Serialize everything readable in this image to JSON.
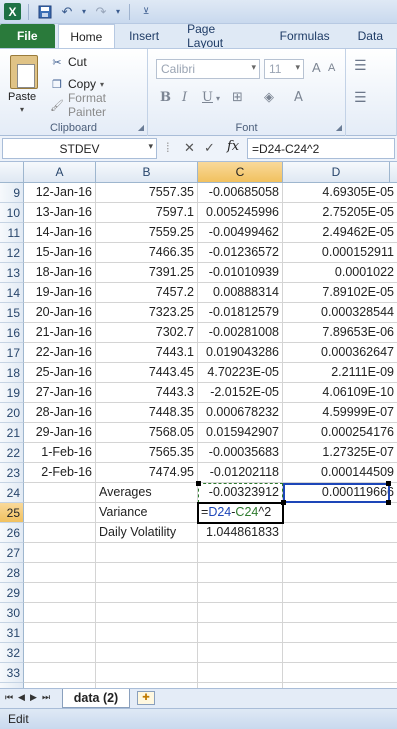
{
  "quick_access": {
    "app_icon_label": "X",
    "icons": [
      "save-icon",
      "undo-icon",
      "redo-icon",
      "customize-arrow-icon"
    ]
  },
  "tabs": [
    "File",
    "Home",
    "Insert",
    "Page Layout",
    "Formulas",
    "Data"
  ],
  "ribbon": {
    "clipboard": {
      "paste": "Paste",
      "cut": "Cut",
      "copy": "Copy",
      "format_painter": "Format Painter",
      "label": "Clipboard"
    },
    "font": {
      "font_name": "Calibri",
      "font_size": "11",
      "label": "Font",
      "grow": "A",
      "shrink": "A",
      "bold": "B",
      "italic": "I",
      "underline": "U"
    }
  },
  "formula_bar": {
    "name_box": "STDEV",
    "cancel": "✕",
    "enter": "✓",
    "fx": "fx",
    "formula": "=D24-C24^2"
  },
  "columns": [
    "A",
    "B",
    "C",
    "D"
  ],
  "rows": [
    {
      "n": "9",
      "a": "12-Jan-16",
      "b": "7557.35",
      "c": "-0.00685058",
      "d": "4.69305E-05"
    },
    {
      "n": "10",
      "a": "13-Jan-16",
      "b": "7597.1",
      "c": "0.005245996",
      "d": "2.75205E-05"
    },
    {
      "n": "11",
      "a": "14-Jan-16",
      "b": "7559.25",
      "c": "-0.00499462",
      "d": "2.49462E-05"
    },
    {
      "n": "12",
      "a": "15-Jan-16",
      "b": "7466.35",
      "c": "-0.01236572",
      "d": "0.000152911"
    },
    {
      "n": "13",
      "a": "18-Jan-16",
      "b": "7391.25",
      "c": "-0.01010939",
      "d": "0.0001022"
    },
    {
      "n": "14",
      "a": "19-Jan-16",
      "b": "7457.2",
      "c": "0.00888314",
      "d": "7.89102E-05"
    },
    {
      "n": "15",
      "a": "20-Jan-16",
      "b": "7323.25",
      "c": "-0.01812579",
      "d": "0.000328544"
    },
    {
      "n": "16",
      "a": "21-Jan-16",
      "b": "7302.7",
      "c": "-0.00281008",
      "d": "7.89653E-06"
    },
    {
      "n": "17",
      "a": "22-Jan-16",
      "b": "7443.1",
      "c": "0.019043286",
      "d": "0.000362647"
    },
    {
      "n": "18",
      "a": "25-Jan-16",
      "b": "7443.45",
      "c": "4.70223E-05",
      "d": "2.2111E-09"
    },
    {
      "n": "19",
      "a": "27-Jan-16",
      "b": "7443.3",
      "c": "-2.0152E-05",
      "d": "4.06109E-10"
    },
    {
      "n": "20",
      "a": "28-Jan-16",
      "b": "7448.35",
      "c": "0.000678232",
      "d": "4.59999E-07"
    },
    {
      "n": "21",
      "a": "29-Jan-16",
      "b": "7568.05",
      "c": "0.015942907",
      "d": "0.000254176"
    },
    {
      "n": "22",
      "a": "1-Feb-16",
      "b": "7565.35",
      "c": "-0.00035683",
      "d": "1.27325E-07"
    },
    {
      "n": "23",
      "a": "2-Feb-16",
      "b": "7474.95",
      "c": "-0.01202118",
      "d": "0.000144509"
    },
    {
      "n": "24",
      "a": "",
      "b": "Averages",
      "c": "-0.00323912",
      "d": "0.000119666"
    },
    {
      "n": "25",
      "a": "",
      "b": "Variance",
      "c": "",
      "d": ""
    },
    {
      "n": "26",
      "a": "",
      "b": "Daily Volatility",
      "c": "1.044861833",
      "d": ""
    },
    {
      "n": "27",
      "a": "",
      "b": "",
      "c": "",
      "d": ""
    },
    {
      "n": "28",
      "a": "",
      "b": "",
      "c": "",
      "d": ""
    },
    {
      "n": "29",
      "a": "",
      "b": "",
      "c": "",
      "d": ""
    },
    {
      "n": "30",
      "a": "",
      "b": "",
      "c": "",
      "d": ""
    },
    {
      "n": "31",
      "a": "",
      "b": "",
      "c": "",
      "d": ""
    },
    {
      "n": "32",
      "a": "",
      "b": "",
      "c": "",
      "d": ""
    },
    {
      "n": "33",
      "a": "",
      "b": "",
      "c": "",
      "d": ""
    },
    {
      "n": "34",
      "a": "",
      "b": "",
      "c": "",
      "d": ""
    }
  ],
  "editing_cell": {
    "prefix": "=",
    "ref1": "D24",
    "op": "-",
    "ref2": "C24",
    "suffix": "^2"
  },
  "sheet_tabs": {
    "active": "data (2)"
  },
  "status_bar": {
    "mode": "Edit"
  }
}
